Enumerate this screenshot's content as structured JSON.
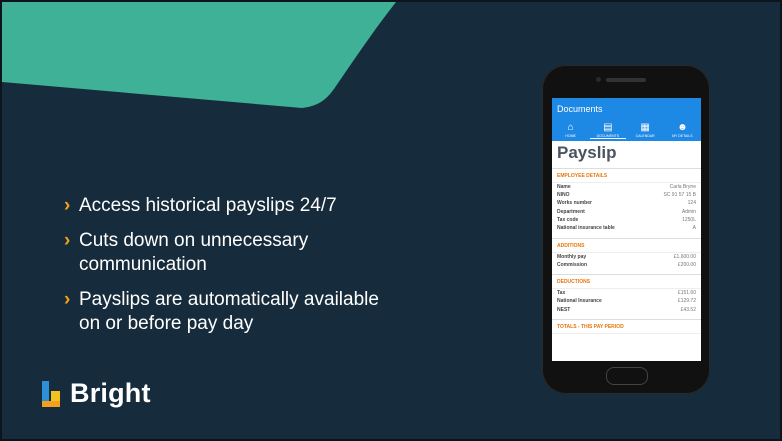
{
  "colors": {
    "background": "#162b3b",
    "teal": "#3fb197",
    "accent": "#f3a01f",
    "app_bar": "#1e88e5",
    "section_heading": "#e8760a"
  },
  "bullets": [
    {
      "lines": [
        "Access historical payslips 24/7"
      ]
    },
    {
      "lines": [
        "Cuts down on unnecessary",
        "communication"
      ]
    },
    {
      "lines": [
        "Payslips are automatically available",
        "on or before pay day"
      ]
    }
  ],
  "logo": {
    "text": "Bright"
  },
  "phone": {
    "app_title": "Documents",
    "nav": [
      {
        "label": "HOME",
        "icon": "home-icon"
      },
      {
        "label": "DOCUMENTS",
        "icon": "document-icon"
      },
      {
        "label": "CALENDAR",
        "icon": "calendar-icon"
      },
      {
        "label": "MY DETAILS",
        "icon": "person-icon"
      }
    ],
    "page_title": "Payslip",
    "employee": {
      "heading": "EMPLOYEE DETAILS",
      "rows": [
        {
          "label": "Name",
          "value": "Carla Bryne"
        },
        {
          "label": "NINO",
          "value": "SC 91 57 15 B"
        },
        {
          "label": "Works number",
          "value": "124"
        },
        {
          "label": "Department",
          "value": "Admin"
        },
        {
          "label": "Tax code",
          "value": "1250L"
        },
        {
          "label": "National insurance table",
          "value": "A"
        }
      ]
    },
    "additions": {
      "heading": "ADDITIONS",
      "rows": [
        {
          "label": "Monthly pay",
          "value": "£1,600.00"
        },
        {
          "label": "Commission",
          "value": "£200.00"
        }
      ]
    },
    "deductions": {
      "heading": "DEDUCTIONS",
      "rows": [
        {
          "label": "Tax",
          "value": "£151.60"
        },
        {
          "label": "National Insurance",
          "value": "£129.72"
        },
        {
          "label": "NEST",
          "value": "£43.52"
        }
      ]
    },
    "totals": {
      "heading": "TOTALS - THIS PAY PERIOD"
    }
  }
}
